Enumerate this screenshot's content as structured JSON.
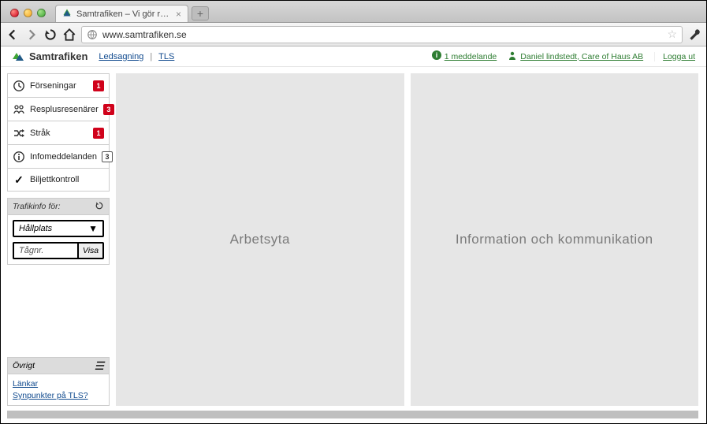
{
  "browser": {
    "tab_title": "Samtrafiken – Vi gör resand",
    "url": "www.samtrafiken.se"
  },
  "header": {
    "brand": "Samtrafiken",
    "links": {
      "ledsagning": "Ledsagning",
      "tls": "TLS"
    },
    "messages": {
      "count": "1",
      "label": "1 meddelande"
    },
    "user": "Daniel lindstedt, Care of Haus AB",
    "logout": "Logga ut"
  },
  "sidebar": {
    "items": [
      {
        "label": "Förseningar",
        "badge": "1",
        "badge_style": "red"
      },
      {
        "label": "Resplusresenärer",
        "badge": "3",
        "badge_style": "red"
      },
      {
        "label": "Stråk",
        "badge": "1",
        "badge_style": "red"
      },
      {
        "label": "Infomeddelanden",
        "badge": "3",
        "badge_style": "outline"
      },
      {
        "label": "Biljettkontroll"
      }
    ],
    "filter": {
      "heading": "Trafikinfo för:",
      "stop_placeholder": "Hållplats",
      "train_placeholder": "Tågnr.",
      "show_btn": "Visa"
    },
    "other": {
      "heading": "Övrigt",
      "links": {
        "lankar": "Länkar",
        "synpunkter": "Synpunkter på TLS?"
      }
    }
  },
  "panels": {
    "left": "Arbetsyta",
    "right": "Information och kommunikation"
  }
}
